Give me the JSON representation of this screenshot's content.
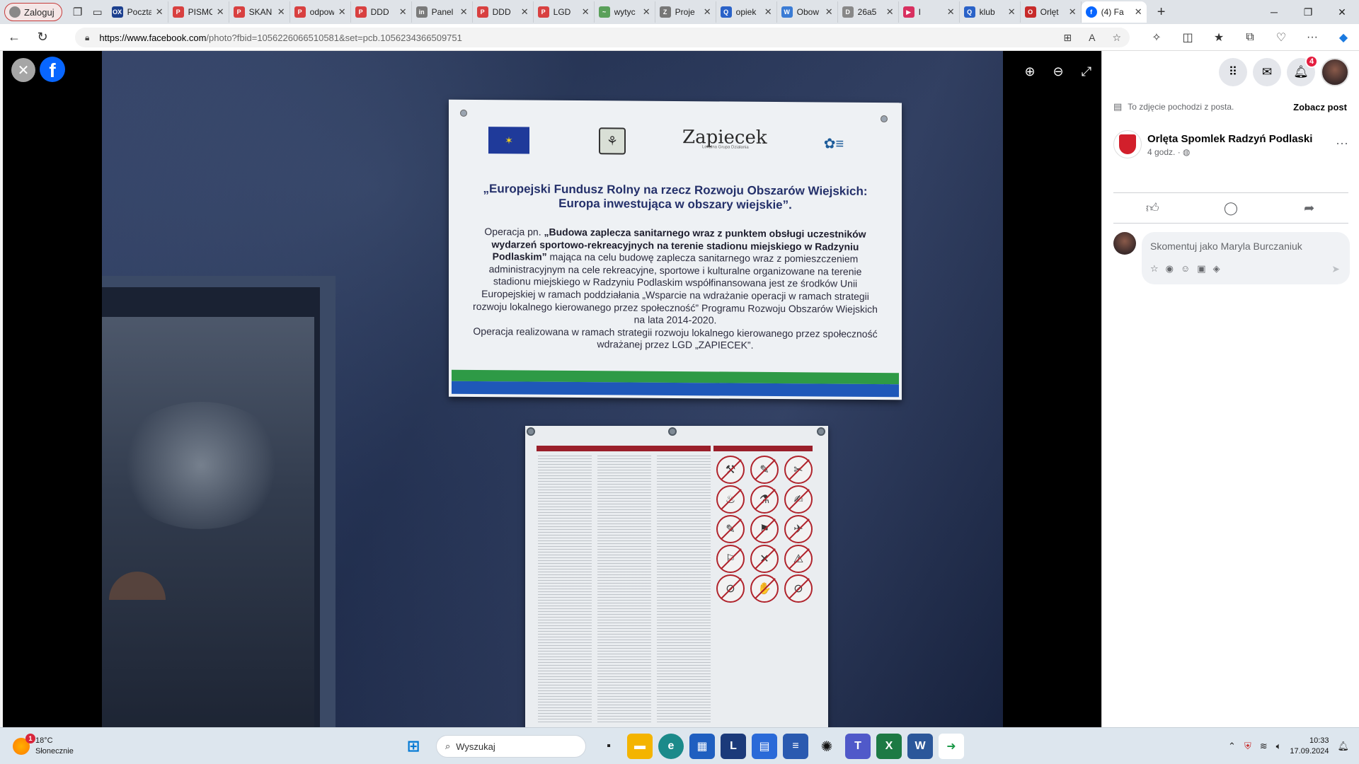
{
  "browser": {
    "profile_label": "Zaloguj",
    "tabs": [
      {
        "label": "Poczta",
        "fav": "OX",
        "color": "#1c3f8e"
      },
      {
        "label": "PISMO",
        "fav": "P",
        "color": "#d84040"
      },
      {
        "label": "SKAN",
        "fav": "P",
        "color": "#d84040"
      },
      {
        "label": "odpow",
        "fav": "P",
        "color": "#d84040"
      },
      {
        "label": "DDD",
        "fav": "P",
        "color": "#d84040"
      },
      {
        "label": "Panel",
        "fav": "in",
        "color": "#7a7a7a"
      },
      {
        "label": "DDD",
        "fav": "P",
        "color": "#d84040"
      },
      {
        "label": "LGD",
        "fav": "P",
        "color": "#d84040"
      },
      {
        "label": "wytyc",
        "fav": "~",
        "color": "#5aa05a"
      },
      {
        "label": "Proje",
        "fav": "Z",
        "color": "#777777"
      },
      {
        "label": "opiek",
        "fav": "Q",
        "color": "#2a62c8"
      },
      {
        "label": "Obow",
        "fav": "W",
        "color": "#3a7bd5"
      },
      {
        "label": "26a5",
        "fav": "D",
        "color": "#888888"
      },
      {
        "label": "I",
        "fav": "▶",
        "color": "#d83060"
      },
      {
        "label": "klub",
        "fav": "Q",
        "color": "#2a62c8"
      },
      {
        "label": "Orlęt",
        "fav": "O",
        "color": "#c72a2a"
      }
    ],
    "active_tab": {
      "label": "(4) Fa",
      "fav": "f",
      "color": "#0866ff"
    },
    "url_domain": "https://www.facebook.com",
    "url_rest": "/photo?fbid=1056226066510581&set=pcb.1056234366509751"
  },
  "plaque": {
    "heading_line1": "„Europejski Fundusz Rolny na rzecz Rozwoju Obszarów Wiejskich:",
    "heading_line2": "Europa inwestująca w obszary wiejskie”.",
    "zapiecek_name": "Zapiecek",
    "zapiecek_sub": "Lokalna Grupa Działania",
    "body_prefix": "Operacja pn. ",
    "body_bold": "„Budowa zaplecza sanitarnego wraz z punktem obsługi uczestników wydarzeń sportowo-rekreacyjnych na terenie stadionu miejskiego w Radzyniu Podlaskim”",
    "body_rest": " mająca na celu budowę zaplecza sanitarnego wraz z pomieszczeniem administracyjnym na cele rekreacyjne, sportowe i kulturalne organizowane na terenie stadionu miejskiego w Radzyniu Podlaskim współfinansowana jest ze środków Unii Europejskiej w ramach poddziałania „Wsparcie na wdrażanie operacji w ramach strategii rozwoju lokalnego kierowanego przez społeczność” Programu Rozwoju Obszarów Wiejskich na lata 2014-2020.",
    "body_line2": "Operacja realizowana w ramach strategii rozwoju lokalnego kierowanego przez społeczność wdrażanej przez LGD „ZAPIECEK”."
  },
  "side": {
    "notice": "To zdjęcie pochodzi z posta.",
    "see_post": "Zobacz post",
    "poster_name": "Orlęta Spomlek Radzyń Podlaski",
    "poster_time": "4 godz. ·",
    "comment_placeholder": "Skomentuj jako Maryla Burczaniuk",
    "notif_count": "4"
  },
  "taskbar": {
    "temp": "18°C",
    "weather_desc": "Słonecznie",
    "weather_badge": "1",
    "search_label": "Wyszukaj",
    "time": "10:33",
    "date": "17.09.2024"
  }
}
